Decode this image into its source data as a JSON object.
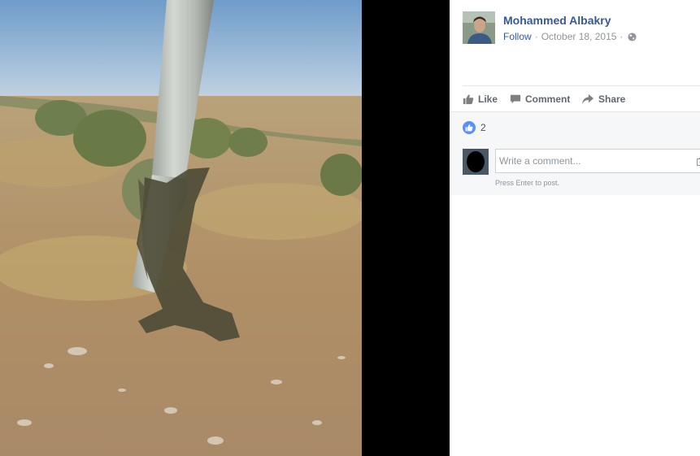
{
  "post": {
    "author_name": "Mohammed Albakry",
    "follow_label": "Follow",
    "separator": "·",
    "date": "October 18, 2015",
    "audience_icon": "globe-icon"
  },
  "photo": {
    "description_icon": "photo"
  },
  "actions": {
    "like_label": "Like",
    "comment_label": "Comment",
    "share_label": "Share"
  },
  "reactions": {
    "count": "2",
    "icon": "like-circle-icon"
  },
  "comment": {
    "placeholder": "Write a comment...",
    "hint": "Press Enter to post."
  },
  "colors": {
    "link": "#365899",
    "muted": "#90949c",
    "action": "#606770",
    "like_blue": "#5890ff",
    "feedback_bg": "#f6f7f9"
  }
}
